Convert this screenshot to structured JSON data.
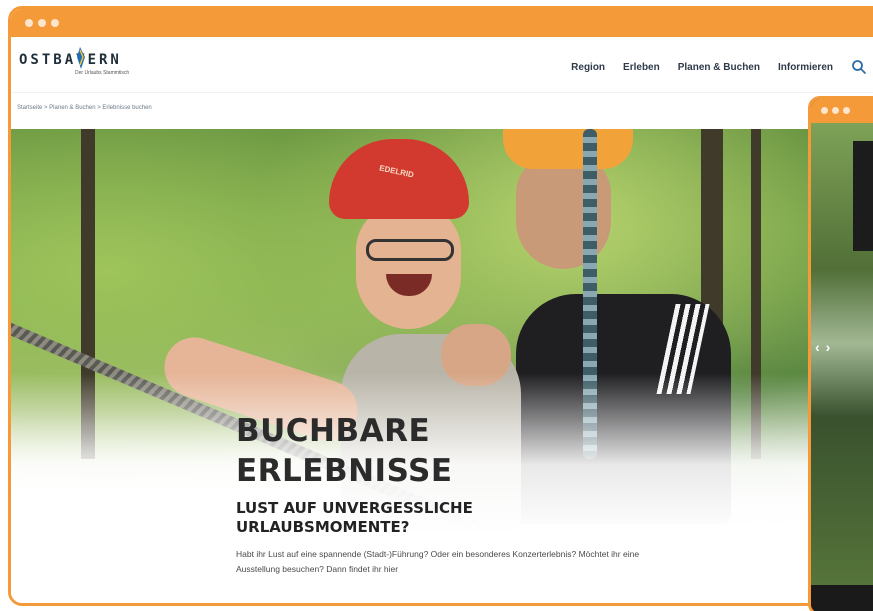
{
  "colors": {
    "accent": "#f59a38",
    "nav_text": "#2f3a4a"
  },
  "header": {
    "logo_text": "OSTBAYERN",
    "logo_tagline": "Der Urlaubs Stammtisch",
    "nav": [
      "Region",
      "Erleben",
      "Planen & Buchen",
      "Informieren"
    ],
    "search_icon": "search-icon"
  },
  "breadcrumb": "Startseite > Planen & Buchen > Erlebnisse buchen",
  "hero": {
    "helmet_text": "EDELRID",
    "title_line1": "BUCHBARE",
    "title_line2": "ERLEBNISSE",
    "subtitle_line1": "LUST AUF UNVERGESSLICHE",
    "subtitle_line2": "URLAUBSMOMENTE?",
    "body": "Habt ihr Lust auf eine spannende (Stadt-)Führung? Oder ein besonderes Konzerterlebnis? Möchtet ihr eine Ausstellung besuchen? Dann findet ihr hier"
  },
  "second_window": {
    "prev_icon": "chevron-left-icon",
    "next_icon": "chevron-right-icon",
    "prev_glyph": "‹",
    "next_glyph": "›"
  }
}
